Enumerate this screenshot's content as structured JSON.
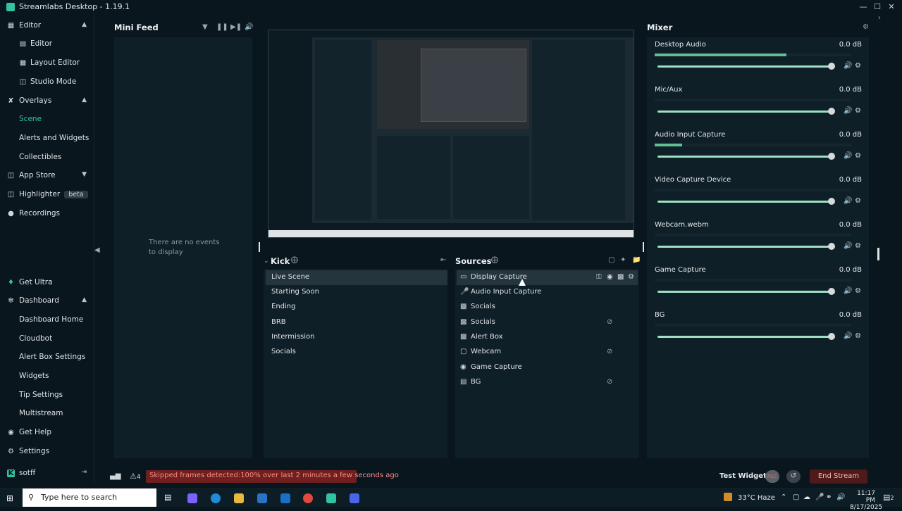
{
  "app": {
    "title": "Streamlabs Desktop - 1.19.1"
  },
  "sidebar": {
    "items": [
      {
        "label": "Editor",
        "icon": "editor-icon",
        "chevron": "⌃"
      },
      {
        "label": "Editor",
        "icon": "editor-layout-icon"
      },
      {
        "label": "Layout Editor",
        "icon": "layout-editor-icon"
      },
      {
        "label": "Studio Mode",
        "icon": "studio-mode-icon"
      },
      {
        "label": "Overlays",
        "icon": "overlays-icon",
        "chevron": "⌃"
      },
      {
        "label": "Scene"
      },
      {
        "label": "Alerts and Widgets"
      },
      {
        "label": "Collectibles"
      },
      {
        "label": "App Store",
        "icon": "app-store-icon",
        "chevron": "⌄"
      },
      {
        "label": "Highlighter",
        "icon": "highlighter-icon",
        "badge": "beta"
      },
      {
        "label": "Recordings",
        "icon": "recordings-icon"
      },
      {
        "label": "Get Ultra",
        "icon": "ultra-icon"
      },
      {
        "label": "Dashboard",
        "icon": "dashboard-icon",
        "chevron": "⌃"
      },
      {
        "label": "Dashboard Home"
      },
      {
        "label": "Cloudbot"
      },
      {
        "label": "Alert Box Settings"
      },
      {
        "label": "Widgets"
      },
      {
        "label": "Tip Settings"
      },
      {
        "label": "Multistream"
      },
      {
        "label": "Get Help",
        "icon": "help-icon"
      },
      {
        "label": "Settings",
        "icon": "gear-icon"
      }
    ],
    "user": "sotff"
  },
  "minifeed": {
    "title": "Mini Feed",
    "empty": "There are no events to display"
  },
  "scenes": {
    "title": "Kick",
    "items": [
      "Live Scene",
      "Starting Soon",
      "Ending",
      "BRB",
      "Intermission",
      "Socials"
    ],
    "selected": "Live Scene"
  },
  "sources": {
    "title": "Sources",
    "items": [
      {
        "label": "Display Capture",
        "icon": "monitor-icon"
      },
      {
        "label": "Audio Input Capture",
        "icon": "mic-icon"
      },
      {
        "label": "Socials",
        "icon": "image-icon"
      },
      {
        "label": "Socials",
        "icon": "image-icon",
        "hidden": true
      },
      {
        "label": "Alert Box",
        "icon": "image-icon"
      },
      {
        "label": "Webcam",
        "icon": "folder-icon",
        "hidden": true
      },
      {
        "label": "Game Capture",
        "icon": "gamepad-icon"
      },
      {
        "label": "BG",
        "icon": "file-icon",
        "hidden": true
      }
    ]
  },
  "mixer": {
    "title": "Mixer",
    "channels": [
      {
        "name": "Desktop Audio",
        "db": "0.0 dB",
        "level": 0.67
      },
      {
        "name": "Mic/Aux",
        "db": "0.0 dB",
        "level": 0.0
      },
      {
        "name": "Audio Input Capture",
        "db": "0.0 dB",
        "level": 0.14
      },
      {
        "name": "Video Capture Device",
        "db": "0.0 dB",
        "level": 0.0
      },
      {
        "name": "Webcam.webm",
        "db": "0.0 dB",
        "level": 0.0
      },
      {
        "name": "Game Capture",
        "db": "0.0 dB",
        "level": 0.0
      },
      {
        "name": "BG",
        "db": "0.0 dB",
        "level": 0.0
      }
    ]
  },
  "footer": {
    "warn_count": "4",
    "warning": "Skipped frames detected:100% over last 2 minutes a few seconds ago",
    "test_widgets": "Test Widgets",
    "rec": "REC",
    "end_stream": "End Stream"
  },
  "taskbar": {
    "search_placeholder": "Type here to search",
    "weather": "33°C Haze",
    "time": "11:17 PM",
    "date": "8/17/2025",
    "notif_count": "2"
  },
  "colors": {
    "accent": "#31c3a2",
    "panel": "#0f1f27",
    "bg": "#09161d",
    "meter": "#61bf93"
  }
}
